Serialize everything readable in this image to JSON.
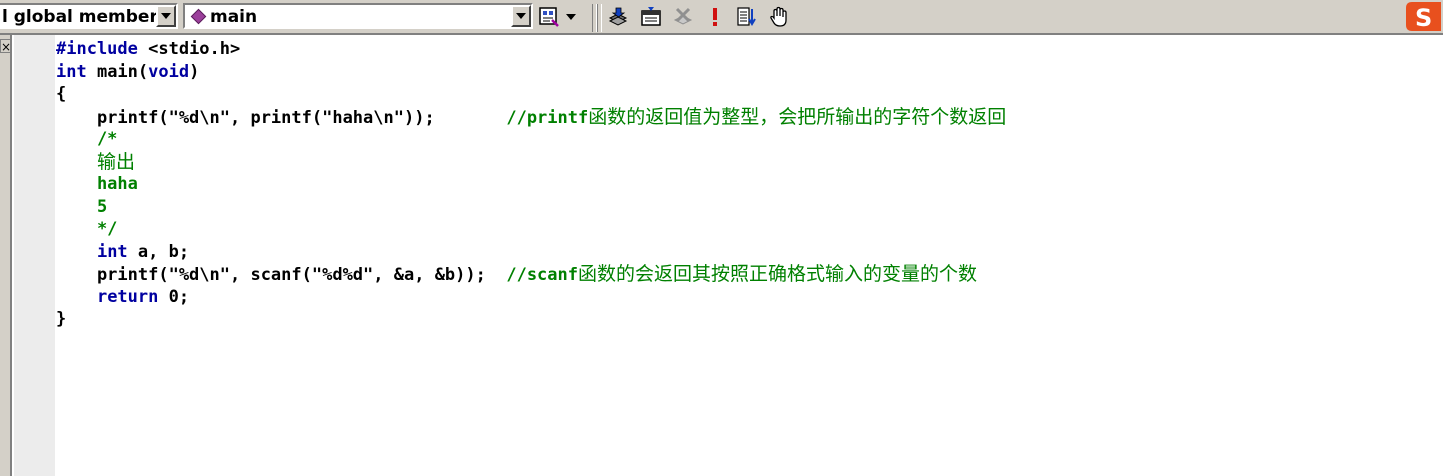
{
  "toolbar": {
    "scope_combo": "l global members",
    "function_combo": "main",
    "icons": [
      "class-wizard-icon",
      "dropdown-arrow-icon",
      "compile-icon",
      "build-icon",
      "stop-build-icon",
      "execute-icon",
      "go-icon",
      "breakpoint-hand-icon"
    ]
  },
  "left_panel": {
    "close_glyph": "×"
  },
  "code": {
    "l1_kw": "#include",
    "l1_rest": " <stdio.h>",
    "l2_kw": "int",
    "l2_rest": " main(",
    "l2_kw2": "void",
    "l2_end": ")",
    "l3": "{",
    "l4_code": "    printf(\"%d\\n\", printf(\"haha\\n\"));       ",
    "l4_comment_a": "//printf",
    "l4_comment_b": "函数的返回值为整型，会把所输出的字符个数返回",
    "l5": "    /*",
    "l6_indent": "    ",
    "l6": "输出",
    "l7": "    haha",
    "l8": "    5",
    "l9": "    */",
    "l10_indent": "    ",
    "l10_kw": "int",
    "l10_rest": " a, b;",
    "l11_code": "    printf(\"%d\\n\", scanf(\"%d%d\", &a, &b));  ",
    "l11_comment_a": "//scanf",
    "l11_comment_b": "函数的会返回其按照正确格式输入的变量的个数",
    "l12_indent": "    ",
    "l12_kw": "return",
    "l12_rest": " 0;",
    "l13": "}"
  },
  "ime": {
    "logo_letter": "S",
    "color": "#e8501e"
  },
  "colors": {
    "keyword": "#0000a0",
    "comment": "#008000",
    "toolbar_bg": "#d4d0c8"
  }
}
